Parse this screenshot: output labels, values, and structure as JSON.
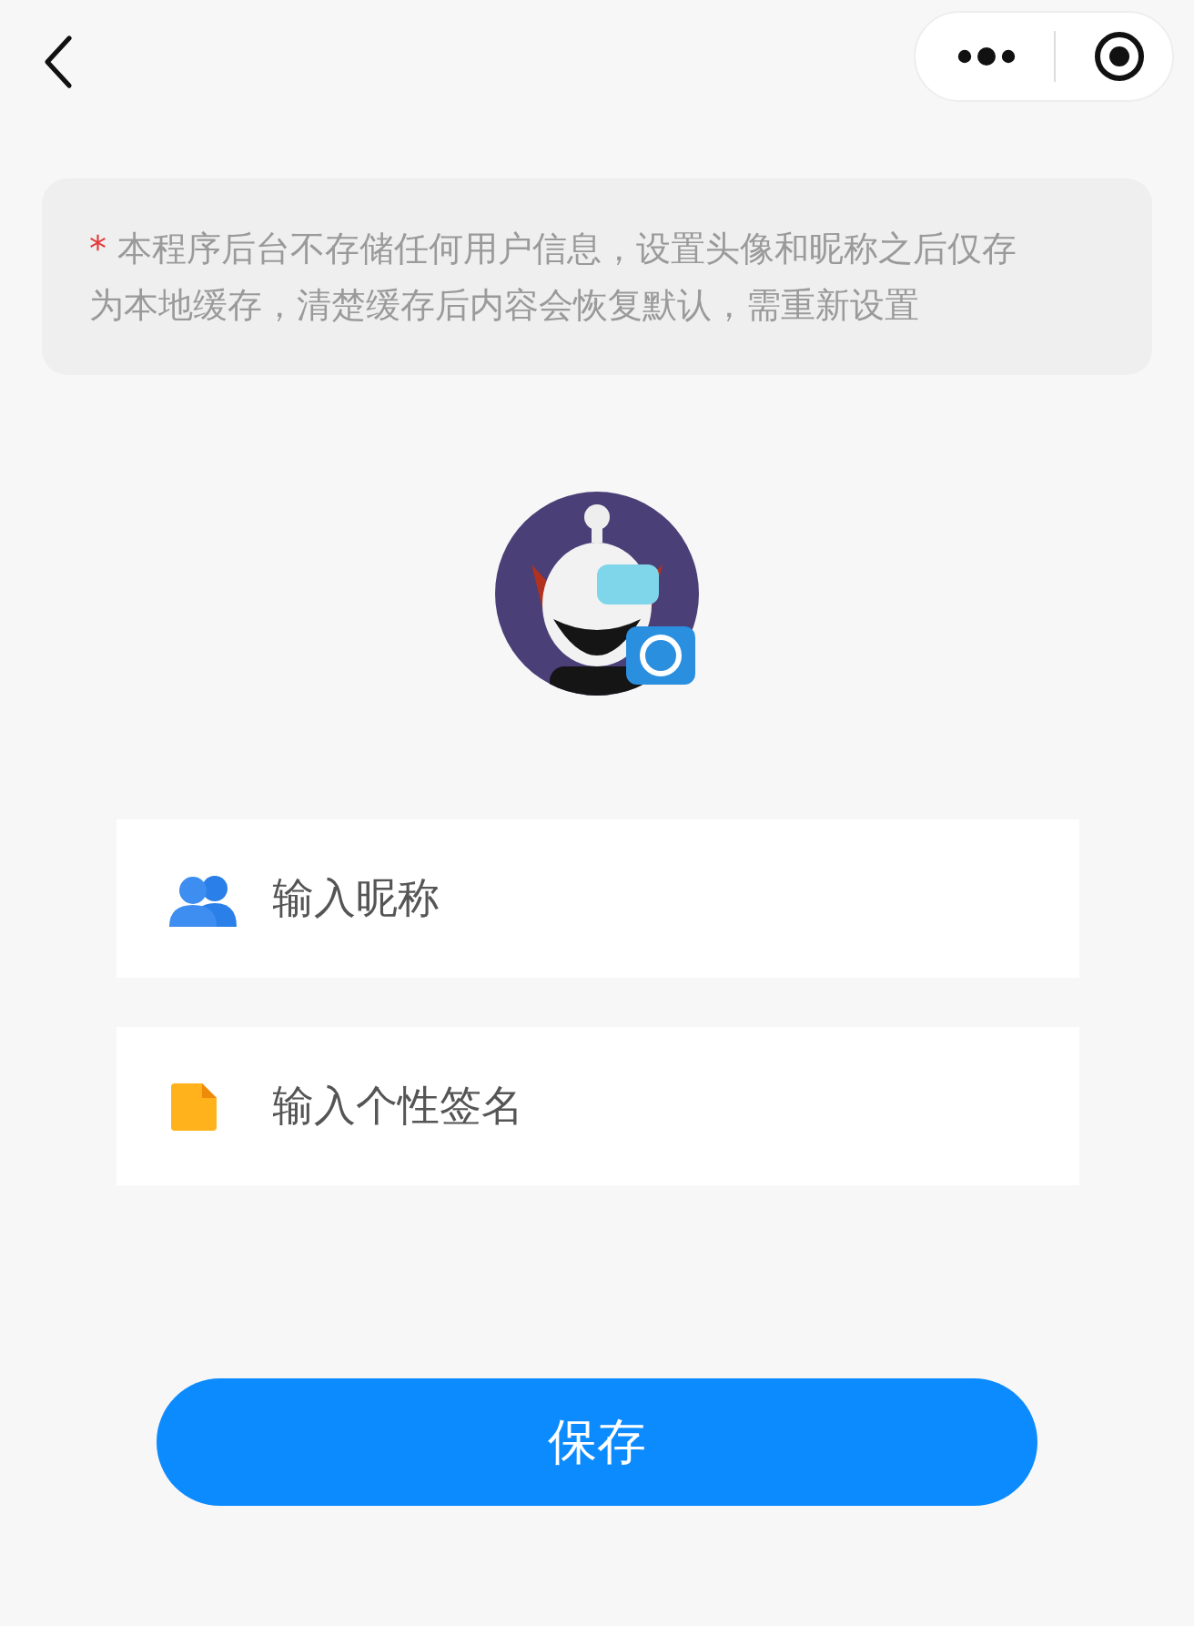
{
  "notice": {
    "marker": "*",
    "text": "本程序后台不存储任何用户信息，设置头像和昵称之后仅存为本地缓存，清楚缓存后内容会恢复默认，需重新设置"
  },
  "fields": [
    {
      "kind": "nickname",
      "placeholder": "输入昵称"
    },
    {
      "kind": "signature",
      "placeholder": "输入个性签名"
    }
  ],
  "save_button": {
    "label": "保存"
  }
}
